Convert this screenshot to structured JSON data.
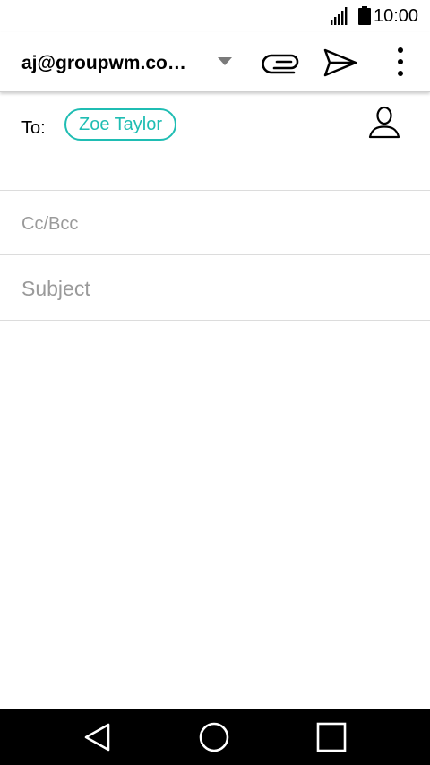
{
  "status_bar": {
    "time": "10:00",
    "icons": [
      "signal-icon",
      "battery-icon"
    ]
  },
  "toolbar": {
    "account": "aj@groupwm.co…",
    "icons": [
      "chevron-down-icon",
      "paperclip-icon",
      "send-icon",
      "more-vert-icon"
    ]
  },
  "compose": {
    "to_label": "To:",
    "recipients": [
      "Zoe Taylor"
    ],
    "contacts_icon": "person-icon",
    "cc_placeholder": "Cc/Bcc",
    "cc_value": "",
    "subject_placeholder": "Subject",
    "subject_value": "",
    "body_value": ""
  },
  "nav_bar": {
    "icons": [
      "back-icon",
      "home-icon",
      "recents-icon"
    ]
  },
  "colors": {
    "accent": "#1fbdb3",
    "divider": "#dcdcdc",
    "placeholder": "#9a9a9a",
    "nav_bar": "#000000"
  }
}
